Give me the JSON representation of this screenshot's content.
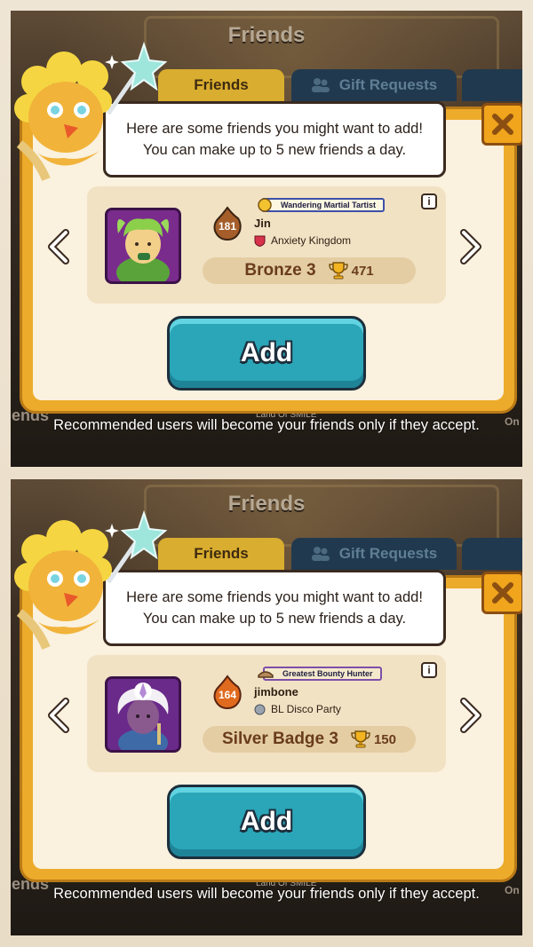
{
  "panels": [
    {
      "bg_title": "Friends",
      "tabs": {
        "active": "Friends",
        "inactive": "Gift Requests"
      },
      "speech": {
        "line1": "Here are some friends you might want to add!",
        "line2": "You can make up to 5 new friends a day."
      },
      "player": {
        "level": "181",
        "title": "Wandering Martial Tartist",
        "name": "Jin",
        "guild": "Anxiety Kingdom",
        "rank": "Bronze 3",
        "trophies": "471"
      },
      "add_label": "Add",
      "caption": "Recommended users will become your friends only if they accept.",
      "bg_left": "iends",
      "bg_mid": "Land Of SMILE",
      "bg_right": "On"
    },
    {
      "bg_title": "Friends",
      "tabs": {
        "active": "Friends",
        "inactive": "Gift Requests"
      },
      "speech": {
        "line1": "Here are some friends you might want to add!",
        "line2": "You can make up to 5 new friends a day."
      },
      "player": {
        "level": "164",
        "title": "Greatest Bounty Hunter",
        "name": "jimbone",
        "guild": "BL Disco Party",
        "rank": "Silver Badge 3",
        "trophies": "150"
      },
      "add_label": "Add",
      "caption": "Recommended users will become your friends only if they accept.",
      "bg_left": "iends",
      "bg_mid": "Land Of SMILE",
      "bg_right": "On"
    }
  ],
  "icons": {
    "close": "close-x-icon",
    "info": "info-icon",
    "arrow_left": "chevron-left-icon",
    "arrow_right": "chevron-right-icon",
    "trophy": "trophy-icon"
  },
  "colors": {
    "dialog_orange": "#ecab2b",
    "add_teal": "#2aa6b8",
    "tab_active": "#d9ad2f",
    "tab_inactive": "#20394e"
  }
}
